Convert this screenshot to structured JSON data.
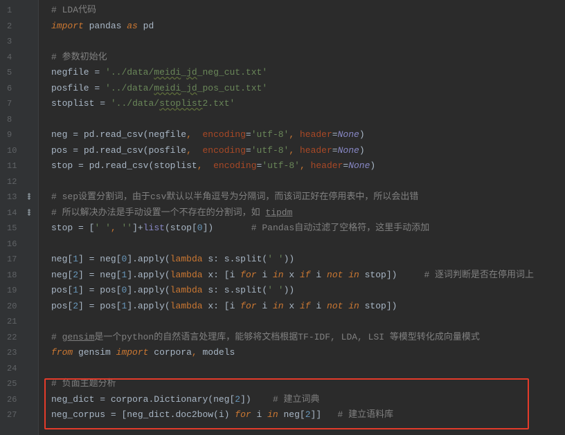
{
  "lineCount": 27,
  "lines": {
    "1": "<span class=\"c-comment\"># LDA代码</span>",
    "2": "<span class=\"c-keyword\">import</span> <span class=\"c-name\">pandas </span><span class=\"c-keyword\">as</span> <span class=\"c-name\">pd</span>",
    "3": "",
    "4": "<span class=\"c-comment\"># 参数初始化</span>",
    "5": "<span class=\"c-name\">negfile</span> <span class=\"c-op\">=</span> <span class=\"c-string\">'../data/<u>meidi</u>_<u>jd</u>_neg_cut.txt'</span>",
    "6": "<span class=\"c-name\">posfile</span> <span class=\"c-op\">=</span> <span class=\"c-string\">'../data/<u>meidi</u>_<u>jd</u>_pos_cut.txt'</span>",
    "7": "<span class=\"c-name\">stoplist</span> <span class=\"c-op\">=</span> <span class=\"c-string\">'../data/<u>stoplist</u>2.txt'</span>",
    "8": "",
    "9": "<span class=\"c-name\">neg</span> <span class=\"c-op\">=</span> <span class=\"c-name\">pd.read_csv(negfile</span><span class=\"c-kwplain\">,</span>  <span class=\"c-param\">encoding</span><span class=\"c-op\">=</span><span class=\"c-string\">'utf-8'</span><span class=\"c-kwplain\">,</span> <span class=\"c-param\">header</span><span class=\"c-op\">=</span><span class=\"c-builtin-i\">None</span><span class=\"c-name\">)</span>",
    "10": "<span class=\"c-name\">pos</span> <span class=\"c-op\">=</span> <span class=\"c-name\">pd.read_csv(posfile</span><span class=\"c-kwplain\">,</span>  <span class=\"c-param\">encoding</span><span class=\"c-op\">=</span><span class=\"c-string\">'utf-8'</span><span class=\"c-kwplain\">,</span> <span class=\"c-param\">header</span><span class=\"c-op\">=</span><span class=\"c-builtin-i\">None</span><span class=\"c-name\">)</span>",
    "11": "<span class=\"c-name\">stop</span> <span class=\"c-op\">=</span> <span class=\"c-name\">pd.read_csv(stoplist</span><span class=\"c-kwplain\">,</span>  <span class=\"c-param\">encoding</span><span class=\"c-op\">=</span><span class=\"c-string\">'utf-8'</span><span class=\"c-kwplain\">,</span> <span class=\"c-param\">header</span><span class=\"c-op\">=</span><span class=\"c-builtin-i\">None</span><span class=\"c-name\">)</span>",
    "12": "",
    "13": "<span class=\"c-comment\"># sep设置分割词，由于csv默认以半角逗号为分隔词，而该词正好在停用表中，所以会出错</span>",
    "14": "<span class=\"c-comment\"># 所以解决办法是手动设置一个不存在的分割词，如 <u>tipdm</u></span>",
    "15": "<span class=\"c-name\">stop</span> <span class=\"c-op\">=</span> <span class=\"c-name\">[</span><span class=\"c-string\">' '</span><span class=\"c-kwplain\">,</span> <span class=\"c-string\">''</span><span class=\"c-name\">]+</span><span class=\"c-builtin\">list</span><span class=\"c-name\">(stop[</span><span class=\"c-num\">0</span><span class=\"c-name\">])</span>       <span class=\"c-comment\"># Pandas自动过滤了空格符，这里手动添加</span>",
    "16": "",
    "17": "<span class=\"c-name\">neg[</span><span class=\"c-num\">1</span><span class=\"c-name\">]</span> <span class=\"c-op\">=</span> <span class=\"c-name\">neg[</span><span class=\"c-num\">0</span><span class=\"c-name\">].apply(</span><span class=\"c-kwplain\">lambda</span> <span class=\"c-name\">s: s.split(</span><span class=\"c-string\">' '</span><span class=\"c-name\">))</span>",
    "18": "<span class=\"c-name\">neg[</span><span class=\"c-num\">2</span><span class=\"c-name\">]</span> <span class=\"c-op\">=</span> <span class=\"c-name\">neg[</span><span class=\"c-num\">1</span><span class=\"c-name\">].apply(</span><span class=\"c-kwplain\">lambda</span> <span class=\"c-name\">x: [i </span><span class=\"c-keyword\">for</span><span class=\"c-name\"> i </span><span class=\"c-keyword\">in</span><span class=\"c-name\"> x </span><span class=\"c-keyword\">if</span><span class=\"c-name\"> i </span><span class=\"c-keyword\">not in</span><span class=\"c-name\"> stop])</span>     <span class=\"c-comment\"># 逐词判断是否在停用词上</span>",
    "19": "<span class=\"c-name\">pos[</span><span class=\"c-num\">1</span><span class=\"c-name\">]</span> <span class=\"c-op\">=</span> <span class=\"c-name\">pos[</span><span class=\"c-num\">0</span><span class=\"c-name\">].apply(</span><span class=\"c-kwplain\">lambda</span> <span class=\"c-name\">s: s.split(</span><span class=\"c-string\">' '</span><span class=\"c-name\">))</span>",
    "20": "<span class=\"c-name\">pos[</span><span class=\"c-num\">2</span><span class=\"c-name\">]</span> <span class=\"c-op\">=</span> <span class=\"c-name\">pos[</span><span class=\"c-num\">1</span><span class=\"c-name\">].apply(</span><span class=\"c-kwplain\">lambda</span> <span class=\"c-name\">x: [i </span><span class=\"c-keyword\">for</span><span class=\"c-name\"> i </span><span class=\"c-keyword\">in</span><span class=\"c-name\"> x </span><span class=\"c-keyword\">if</span><span class=\"c-name\"> i </span><span class=\"c-keyword\">not in</span><span class=\"c-name\"> stop])</span>",
    "21": "",
    "22": "<span class=\"c-comment\"># <u>gensim</u>是一个python的自然语言处理库，能够将文档根据TF-IDF, LDA, LSI 等模型转化成向量模式</span>",
    "23": "<span class=\"c-keyword\">from</span> <span class=\"c-name\">gensim </span><span class=\"c-keyword\">import</span> <span class=\"c-name\">corpora</span><span class=\"c-kwplain\">,</span> <span class=\"c-name\">models</span>",
    "24": "",
    "25": "<span class=\"c-comment\"># 负面主题分析</span>",
    "26": "<span class=\"c-name\">neg_dict</span> <span class=\"c-op\">=</span> <span class=\"c-name\">corpora.Dictionary(neg[</span><span class=\"c-num\">2</span><span class=\"c-name\">])</span>    <span class=\"c-comment\"># 建立词典</span>",
    "27": "<span class=\"c-name\">neg_corpus</span> <span class=\"c-op\">=</span> <span class=\"c-name\">[neg_dict.doc2bow(i) </span><span class=\"c-keyword\">for</span><span class=\"c-name\"> i </span><span class=\"c-keyword\">in</span><span class=\"c-name\"> neg[</span><span class=\"c-num\">2</span><span class=\"c-name\">]]</span>   <span class=\"c-comment\"># 建立语料库</span>"
  },
  "gutterIcons": {
    "13": "changes",
    "14": "changes"
  }
}
